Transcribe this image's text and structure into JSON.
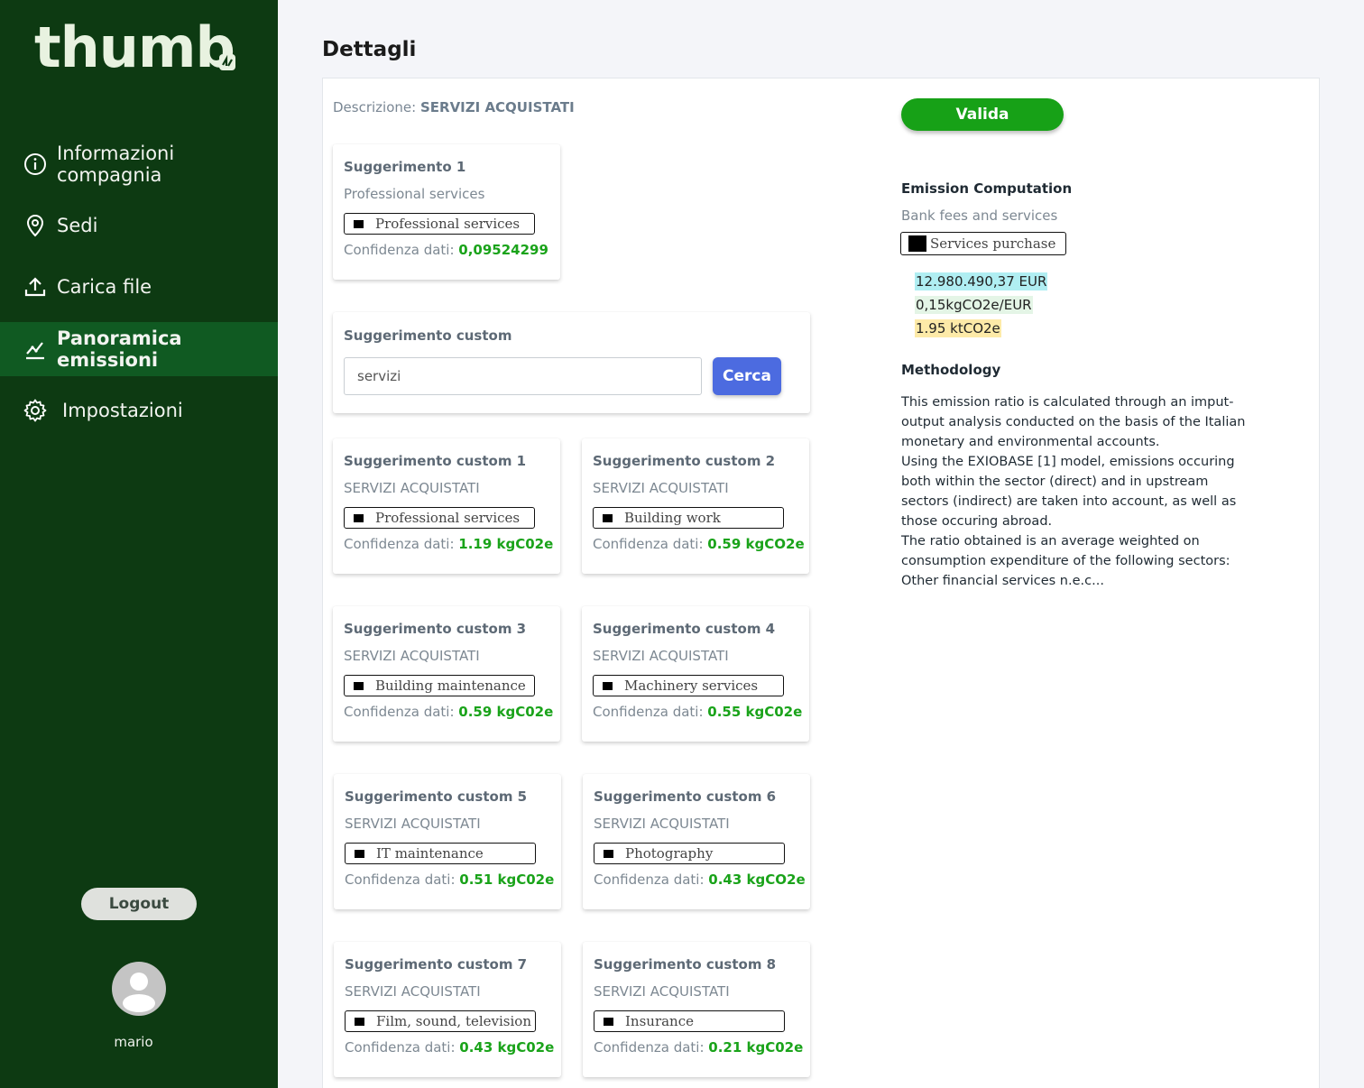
{
  "sidebar": {
    "logo": "thumb",
    "nav": [
      {
        "label": "Informazioni compagnia",
        "icon": "info-icon"
      },
      {
        "label": "Sedi",
        "icon": "location-pin-icon"
      },
      {
        "label": "Carica file",
        "icon": "upload-icon"
      },
      {
        "label": "Panoramica emissioni",
        "icon": "chart-line-icon",
        "active": true
      },
      {
        "label": "Impostazioni",
        "icon": "gear-icon"
      }
    ],
    "logout_label": "Logout",
    "username": "mario"
  },
  "header": {
    "title": "Dettagli"
  },
  "details": {
    "description_label": "Descrizione:",
    "description_value": "SERVIZI ACQUISTATI",
    "confidence_label": "Confidenza dati:",
    "suggestion": {
      "title": "Suggerimento 1",
      "subtitle": "Professional services",
      "tag": "Professional services",
      "confidence": "0,09524299"
    },
    "custom": {
      "title": "Suggerimento custom",
      "input_value": "servizi",
      "search_label": "Cerca"
    },
    "custom_cards": [
      {
        "title": "Suggerimento custom 1",
        "subtitle": "SERVIZI ACQUISTATI",
        "tag": "Professional services",
        "confidence": "1.19 kgC02e"
      },
      {
        "title": "Suggerimento custom 2",
        "subtitle": "SERVIZI ACQUISTATI",
        "tag": "Building work",
        "confidence": "0.59 kgCO2e"
      },
      {
        "title": "Suggerimento custom 3",
        "subtitle": "SERVIZI ACQUISTATI",
        "tag": "Building maintenance",
        "confidence": "0.59 kgC02e"
      },
      {
        "title": "Suggerimento custom 4",
        "subtitle": "SERVIZI ACQUISTATI",
        "tag": "Machinery services",
        "confidence": "0.55 kgC02e"
      },
      {
        "title": "Suggerimento custom 5",
        "subtitle": "SERVIZI ACQUISTATI",
        "tag": "IT maintenance",
        "confidence": "0.51 kgC02e"
      },
      {
        "title": "Suggerimento custom 6",
        "subtitle": "SERVIZI ACQUISTATI",
        "tag": "Photography",
        "confidence": "0.43 kgCO2e"
      },
      {
        "title": "Suggerimento custom 7",
        "subtitle": "SERVIZI ACQUISTATI",
        "tag": "Film, sound, television",
        "confidence": "0.43 kgC02e"
      },
      {
        "title": "Suggerimento custom 8",
        "subtitle": "SERVIZI ACQUISTATI",
        "tag": "Insurance",
        "confidence": "0.21 kgC02e"
      }
    ]
  },
  "computation": {
    "validate_label": "Valida",
    "title": "Emission Computation",
    "subtitle": "Bank fees and services",
    "tag": "Services purchase",
    "amount": "12.980.490,37 EUR",
    "factor": "0,15kgCO2e/EUR",
    "total": "1.95 ktCO2e",
    "methodology_title": "Methodology",
    "methodology_lines": [
      "This emission ratio is calculated through an imput-output analysis conducted on the basis of the Italian monetary and environmental accounts.",
      "Using the EXIOBASE [1] model, emissions occuring both within the sector (direct) and in upstream sectors (indirect) are taken into account, as well as those occuring abroad.",
      "The ratio obtained is an average weighted on consumption expenditure of the following sectors: Other financial services n.e.c..."
    ]
  },
  "colors": {
    "sidebar_bg": "#0d3a12",
    "sidebar_active": "#105a22",
    "confidence_green": "#1aa31a",
    "search_button": "#4c6be0",
    "validate_button": "#17a117",
    "highlight_amount": "#b0eef2",
    "highlight_factor": "#e4f5e6",
    "highlight_total": "#fdeaa8"
  }
}
